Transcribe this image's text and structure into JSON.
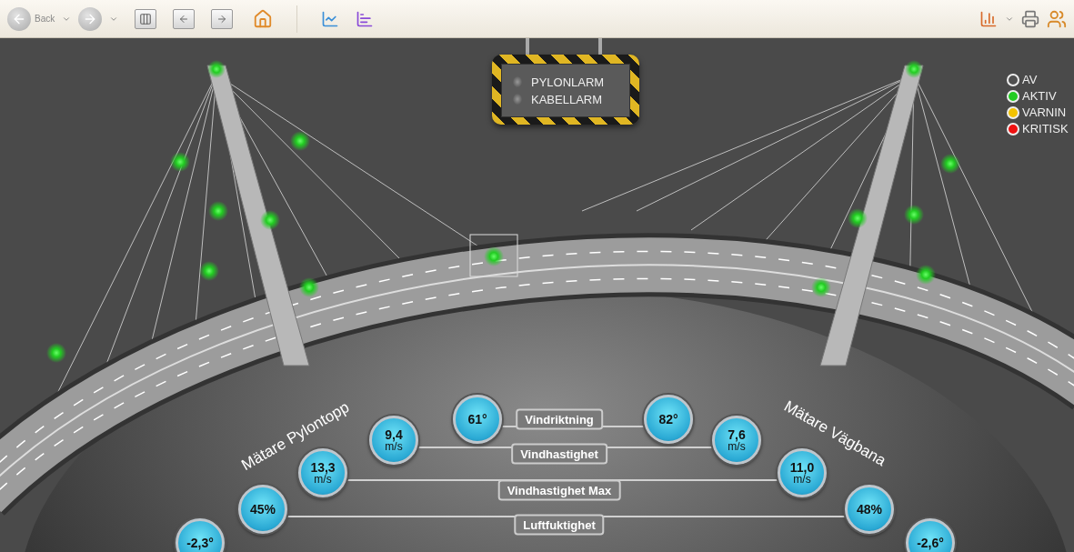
{
  "toolbar": {
    "back_label": "Back"
  },
  "alarms": [
    {
      "label": "PYLONLARM",
      "on": false
    },
    {
      "label": "KABELLARM",
      "on": false
    }
  ],
  "legend": [
    {
      "label": "AV",
      "color": "#505050"
    },
    {
      "label": "AKTIV",
      "color": "#22cc22"
    },
    {
      "label": "VARNIN",
      "color": "#f2c200"
    },
    {
      "label": "KRITISK",
      "color": "#ee1111"
    }
  ],
  "groups": [
    {
      "label": "Mätare Pylontopp"
    },
    {
      "label": "Mätare Vägbana"
    }
  ],
  "gauges": [
    {
      "label": "Vindriktning",
      "left": {
        "value": "61°"
      },
      "right": {
        "value": "82°"
      }
    },
    {
      "label": "Vindhastighet",
      "left": {
        "value": "9,4",
        "unit": "m/s"
      },
      "right": {
        "value": "7,6",
        "unit": "m/s"
      }
    },
    {
      "label": "Vindhastighet Max",
      "left": {
        "value": "13,3",
        "unit": "m/s"
      },
      "right": {
        "value": "11,0",
        "unit": "m/s"
      }
    },
    {
      "label": "Luftfuktighet",
      "left": {
        "value": "45%"
      },
      "right": {
        "value": "48%"
      }
    },
    {
      "left": {
        "value": "-2,3°"
      },
      "right": {
        "value": "-2,6°"
      }
    }
  ]
}
